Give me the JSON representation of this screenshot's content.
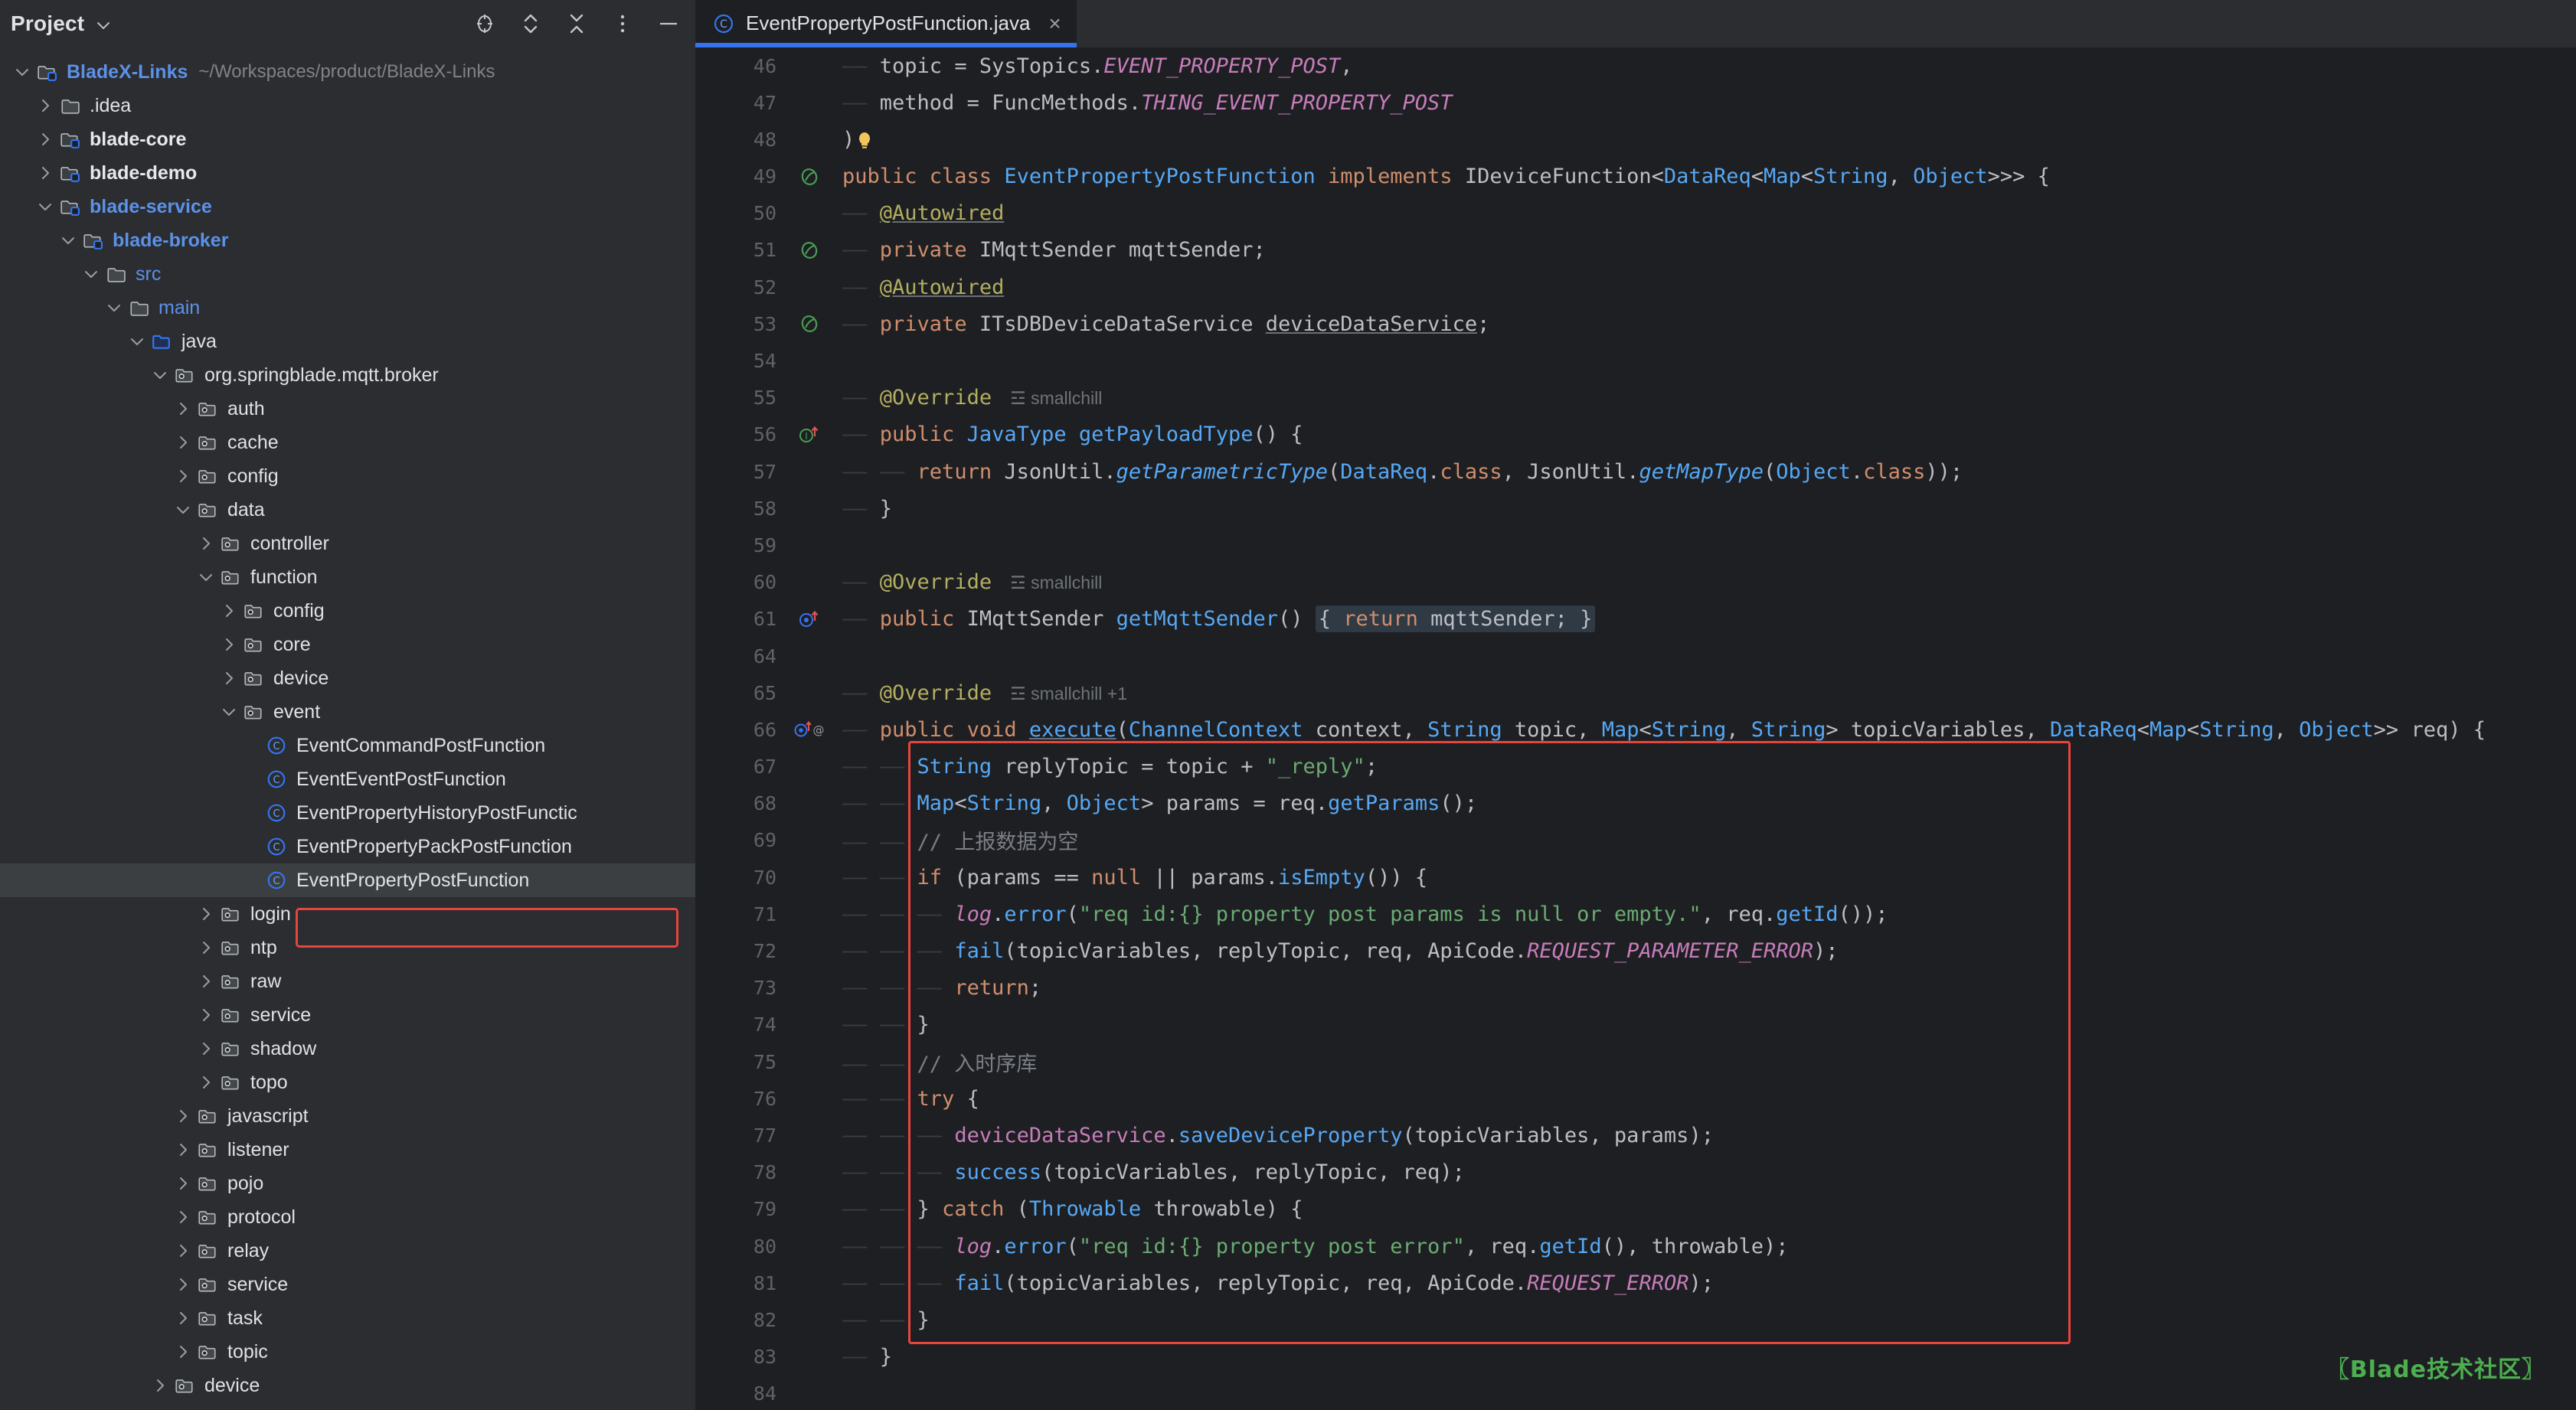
{
  "sidebar": {
    "title": "Project",
    "tools": [
      "locate-icon",
      "collapse-expand-icon",
      "collapse-all-icon",
      "more-options-icon",
      "minimize-icon"
    ],
    "tree": [
      {
        "depth": 0,
        "arrow": "down",
        "icon": "module-folder",
        "label": "BladeX-Links",
        "style": "blue-b",
        "path": "~/Workspaces/product/BladeX-Links"
      },
      {
        "depth": 1,
        "arrow": "right",
        "icon": "folder",
        "label": ".idea",
        "style": "plain"
      },
      {
        "depth": 1,
        "arrow": "right",
        "icon": "module-folder",
        "label": "blade-core",
        "style": "white-b"
      },
      {
        "depth": 1,
        "arrow": "right",
        "icon": "module-folder",
        "label": "blade-demo",
        "style": "white-b"
      },
      {
        "depth": 1,
        "arrow": "down",
        "icon": "module-folder",
        "label": "blade-service",
        "style": "blue-b"
      },
      {
        "depth": 2,
        "arrow": "down",
        "icon": "module-folder",
        "label": "blade-broker",
        "style": "blue-b"
      },
      {
        "depth": 3,
        "arrow": "down",
        "icon": "folder",
        "label": "src",
        "style": "blue"
      },
      {
        "depth": 4,
        "arrow": "down",
        "icon": "folder",
        "label": "main",
        "style": "blue"
      },
      {
        "depth": 5,
        "arrow": "down",
        "icon": "source-folder",
        "label": "java",
        "style": "plain"
      },
      {
        "depth": 6,
        "arrow": "down",
        "icon": "package",
        "label": "org.springblade.mqtt.broker",
        "style": "plain"
      },
      {
        "depth": 7,
        "arrow": "right",
        "icon": "package",
        "label": "auth",
        "style": "plain"
      },
      {
        "depth": 7,
        "arrow": "right",
        "icon": "package",
        "label": "cache",
        "style": "plain"
      },
      {
        "depth": 7,
        "arrow": "right",
        "icon": "package",
        "label": "config",
        "style": "plain"
      },
      {
        "depth": 7,
        "arrow": "down",
        "icon": "package",
        "label": "data",
        "style": "plain"
      },
      {
        "depth": 8,
        "arrow": "right",
        "icon": "package",
        "label": "controller",
        "style": "plain"
      },
      {
        "depth": 8,
        "arrow": "down",
        "icon": "package",
        "label": "function",
        "style": "plain"
      },
      {
        "depth": 9,
        "arrow": "right",
        "icon": "package",
        "label": "config",
        "style": "plain"
      },
      {
        "depth": 9,
        "arrow": "right",
        "icon": "package",
        "label": "core",
        "style": "plain"
      },
      {
        "depth": 9,
        "arrow": "right",
        "icon": "package",
        "label": "device",
        "style": "plain"
      },
      {
        "depth": 9,
        "arrow": "down",
        "icon": "package",
        "label": "event",
        "style": "plain"
      },
      {
        "depth": 10,
        "arrow": "none",
        "icon": "java-class",
        "label": "EventCommandPostFunction",
        "style": "plain"
      },
      {
        "depth": 10,
        "arrow": "none",
        "icon": "java-class",
        "label": "EventEventPostFunction",
        "style": "plain"
      },
      {
        "depth": 10,
        "arrow": "none",
        "icon": "java-class",
        "label": "EventPropertyHistoryPostFunctic",
        "style": "plain"
      },
      {
        "depth": 10,
        "arrow": "none",
        "icon": "java-class",
        "label": "EventPropertyPackPostFunction",
        "style": "plain"
      },
      {
        "depth": 10,
        "arrow": "none",
        "icon": "java-class",
        "label": "EventPropertyPostFunction",
        "style": "plain",
        "selected": true
      },
      {
        "depth": 8,
        "arrow": "right",
        "icon": "package",
        "label": "login",
        "style": "plain"
      },
      {
        "depth": 8,
        "arrow": "right",
        "icon": "package",
        "label": "ntp",
        "style": "plain"
      },
      {
        "depth": 8,
        "arrow": "right",
        "icon": "package",
        "label": "raw",
        "style": "plain"
      },
      {
        "depth": 8,
        "arrow": "right",
        "icon": "package",
        "label": "service",
        "style": "plain"
      },
      {
        "depth": 8,
        "arrow": "right",
        "icon": "package",
        "label": "shadow",
        "style": "plain"
      },
      {
        "depth": 8,
        "arrow": "right",
        "icon": "package",
        "label": "topo",
        "style": "plain"
      },
      {
        "depth": 7,
        "arrow": "right",
        "icon": "package",
        "label": "javascript",
        "style": "plain"
      },
      {
        "depth": 7,
        "arrow": "right",
        "icon": "package",
        "label": "listener",
        "style": "plain"
      },
      {
        "depth": 7,
        "arrow": "right",
        "icon": "package",
        "label": "pojo",
        "style": "plain"
      },
      {
        "depth": 7,
        "arrow": "right",
        "icon": "package",
        "label": "protocol",
        "style": "plain"
      },
      {
        "depth": 7,
        "arrow": "right",
        "icon": "package",
        "label": "relay",
        "style": "plain"
      },
      {
        "depth": 7,
        "arrow": "right",
        "icon": "package",
        "label": "service",
        "style": "plain"
      },
      {
        "depth": 7,
        "arrow": "right",
        "icon": "package",
        "label": "task",
        "style": "plain"
      },
      {
        "depth": 7,
        "arrow": "right",
        "icon": "package",
        "label": "topic",
        "style": "plain"
      },
      {
        "depth": 6,
        "arrow": "right",
        "icon": "package",
        "label": "device",
        "style": "plain"
      }
    ]
  },
  "editor": {
    "tab": {
      "label": "EventPropertyPostFunction.java",
      "icon": "java-class-icon",
      "close": "×"
    },
    "watermark": "Blade技术社区",
    "lines": [
      {
        "n": 46,
        "gutter": "",
        "html": "<span class=\"indent\">—— </span><span class=\"ident\">topic</span> = <span class=\"ident\">SysTopics</span>.<span class=\"sfld\">EVENT_PROPERTY_POST</span>,"
      },
      {
        "n": 47,
        "gutter": "",
        "html": "<span class=\"indent\">—— </span><span class=\"ident\">method</span> = <span class=\"ident\">FuncMethods</span>.<span class=\"sfld\">THING_EVENT_PROPERTY_POST</span>"
      },
      {
        "n": 48,
        "gutter": "",
        "html": ")<span class=\"bulb\"></span>"
      },
      {
        "n": 49,
        "gutter": "impl-green",
        "html": "<span class=\"kw\">public class </span><span class=\"typename\">EventPropertyPostFunction</span> <span class=\"kw\">implements</span> <span class=\"cls\">IDeviceFunction</span>&lt;<span class=\"typename\">DataReq</span>&lt;<span class=\"typename\">Map</span>&lt;<span class=\"typename\">String</span>, <span class=\"typename\">Object</span>&gt;&gt;&gt; {"
      },
      {
        "n": 50,
        "gutter": "",
        "html": "<span class=\"indent\">—— </span><span class=\"ann ulin\">@Autowired</span>"
      },
      {
        "n": 51,
        "gutter": "bean-green",
        "html": "<span class=\"indent\">—— </span><span class=\"kw\">private</span> <span class=\"cls\">IMqttSender</span> <span class=\"ident\">mqttSender</span>;"
      },
      {
        "n": 52,
        "gutter": "",
        "html": "<span class=\"indent\">—— </span><span class=\"ann ulin\">@Autowired</span>"
      },
      {
        "n": 53,
        "gutter": "bean-green",
        "html": "<span class=\"indent\">—— </span><span class=\"kw\">private</span> <span class=\"cls\">ITsDBDeviceDataService</span> <span class=\"ident ulin\">deviceDataService</span>;"
      },
      {
        "n": 54,
        "gutter": "",
        "html": ""
      },
      {
        "n": 55,
        "gutter": "",
        "html": "<span class=\"indent\">—— </span><span class=\"ann\">@Override</span><span class=\"hint\">☲ smallchill</span>"
      },
      {
        "n": 56,
        "gutter": "override",
        "html": "<span class=\"indent\">—— </span><span class=\"kw\">public</span> <span class=\"typename\">JavaType</span> <span class=\"mth\">getPayloadType</span>() {"
      },
      {
        "n": 57,
        "gutter": "",
        "html": "<span class=\"indent\">—— —— </span><span class=\"kw\">return</span> <span class=\"ident\">JsonUtil</span>.<span class=\"mth\" style=\"font-style:italic\">getParametricType</span>(<span class=\"typename\">DataReq</span>.<span class=\"kw\">class</span>, <span class=\"ident\">JsonUtil</span>.<span class=\"mth\" style=\"font-style:italic\">getMapType</span>(<span class=\"typename\">Object</span>.<span class=\"kw\">class</span>));"
      },
      {
        "n": 58,
        "gutter": "",
        "html": "<span class=\"indent\">—— </span>}"
      },
      {
        "n": 59,
        "gutter": "",
        "html": ""
      },
      {
        "n": 60,
        "gutter": "",
        "html": "<span class=\"indent\">—— </span><span class=\"ann\">@Override</span><span class=\"hint\">☲ smallchill</span>"
      },
      {
        "n": 61,
        "gutter": "override-blue",
        "html": "<span class=\"indent\">—— </span><span class=\"kw\">public</span> <span class=\"cls\">IMqttSender</span> <span class=\"mth\">getMqttSender</span>() <span class=\"fold\">{ <span class=\"kw\">return</span> <span class=\"ident\">mqttSender</span>; }</span>"
      },
      {
        "n": 64,
        "gutter": "",
        "html": ""
      },
      {
        "n": 65,
        "gutter": "",
        "html": "<span class=\"indent\">—— </span><span class=\"ann\">@Override</span><span class=\"hint\">☲ smallchill +1</span>"
      },
      {
        "n": 66,
        "gutter": "override-at",
        "html": "<span class=\"indent\">—— </span><span class=\"kw\">public void</span> <span class=\"mth ulin\">execute</span>(<span class=\"typename\">ChannelContext</span> <span class=\"ident\">context</span>, <span class=\"typename\">String</span> <span class=\"ident\">topic</span>, <span class=\"typename\">Map</span>&lt;<span class=\"typename\">String</span>, <span class=\"typename\">String</span>&gt; <span class=\"ident\">topicVariables</span>, <span class=\"typename\">DataReq</span>&lt;<span class=\"typename\">Map</span>&lt;<span class=\"typename\">String</span>, <span class=\"typename\">Object</span>&gt;&gt; <span class=\"ident\">req</span>) {"
      },
      {
        "n": 67,
        "gutter": "",
        "html": "<span class=\"indent\">—— —— </span><span class=\"typename\">String</span> <span class=\"ident\">replyTopic</span> = <span class=\"ident\">topic</span> + <span class=\"str\">\"_reply\"</span>;"
      },
      {
        "n": 68,
        "gutter": "",
        "html": "<span class=\"indent\">—— —— </span><span class=\"typename\">Map</span>&lt;<span class=\"typename\">String</span>, <span class=\"typename\">Object</span>&gt; <span class=\"ident\">params</span> = <span class=\"ident\">req</span>.<span class=\"mth\">getParams</span>();"
      },
      {
        "n": 69,
        "gutter": "",
        "html": "<span class=\"indent\">—— —— </span><span class=\"cmt\">// 上报数据为空</span>"
      },
      {
        "n": 70,
        "gutter": "",
        "html": "<span class=\"indent\">—— —— </span><span class=\"kw\">if</span> (<span class=\"ident\">params</span> == <span class=\"kw\">null</span> || <span class=\"ident\">params</span>.<span class=\"mth\">isEmpty</span>()) {"
      },
      {
        "n": 71,
        "gutter": "",
        "html": "<span class=\"indent\">—— —— —— </span><span class=\"fld\" style=\"font-style:italic\">log</span>.<span class=\"mth\">error</span>(<span class=\"str\">\"req id:{} property post params is null or empty.\"</span>, <span class=\"ident\">req</span>.<span class=\"mth\">getId</span>());"
      },
      {
        "n": 72,
        "gutter": "",
        "html": "<span class=\"indent\">—— —— —— </span><span class=\"mth\">fail</span>(<span class=\"ident\">topicVariables</span>, <span class=\"ident\">replyTopic</span>, <span class=\"ident\">req</span>, <span class=\"ident\">ApiCode</span>.<span class=\"sfld\">REQUEST_PARAMETER_ERROR</span>);"
      },
      {
        "n": 73,
        "gutter": "",
        "html": "<span class=\"indent\">—— —— —— </span><span class=\"kw\">return</span>;"
      },
      {
        "n": 74,
        "gutter": "",
        "html": "<span class=\"indent\">—— —— </span>}"
      },
      {
        "n": 75,
        "gutter": "",
        "html": "<span class=\"indent\">—— —— </span><span class=\"cmt\">// 入时序库</span>"
      },
      {
        "n": 76,
        "gutter": "",
        "html": "<span class=\"indent\">—— —— </span><span class=\"kw\">try</span> {"
      },
      {
        "n": 77,
        "gutter": "",
        "html": "<span class=\"indent\">—— —— —— </span><span class=\"fld\">deviceDataService</span>.<span class=\"mth\">saveDeviceProperty</span>(<span class=\"ident\">topicVariables</span>, <span class=\"ident\">params</span>);"
      },
      {
        "n": 78,
        "gutter": "",
        "html": "<span class=\"indent\">—— —— —— </span><span class=\"mth\">success</span>(<span class=\"ident\">topicVariables</span>, <span class=\"ident\">replyTopic</span>, <span class=\"ident\">req</span>);"
      },
      {
        "n": 79,
        "gutter": "",
        "html": "<span class=\"indent\">—— —— </span>} <span class=\"kw\">catch</span> (<span class=\"typename\">Throwable</span> <span class=\"ident\">throwable</span>) {"
      },
      {
        "n": 80,
        "gutter": "",
        "html": "<span class=\"indent\">—— —— —— </span><span class=\"fld\" style=\"font-style:italic\">log</span>.<span class=\"mth\">error</span>(<span class=\"str\">\"req id:{} property post error\"</span>, <span class=\"ident\">req</span>.<span class=\"mth\">getId</span>(), <span class=\"ident\">throwable</span>);"
      },
      {
        "n": 81,
        "gutter": "",
        "html": "<span class=\"indent\">—— —— —— </span><span class=\"mth\">fail</span>(<span class=\"ident\">topicVariables</span>, <span class=\"ident\">replyTopic</span>, <span class=\"ident\">req</span>, <span class=\"ident\">ApiCode</span>.<span class=\"sfld\">REQUEST_ERROR</span>);"
      },
      {
        "n": 82,
        "gutter": "",
        "html": "<span class=\"indent\">—— —— </span>}"
      },
      {
        "n": 83,
        "gutter": "",
        "html": "<span class=\"indent\">—— </span>}"
      },
      {
        "n": 84,
        "gutter": "",
        "html": ""
      }
    ]
  },
  "colors": {
    "accent": "#3574f0",
    "highlight_box": "#e8453c",
    "sidebar_bg": "#2b2d30",
    "editor_bg": "#1e1f22",
    "watermark": "#4caf50"
  }
}
